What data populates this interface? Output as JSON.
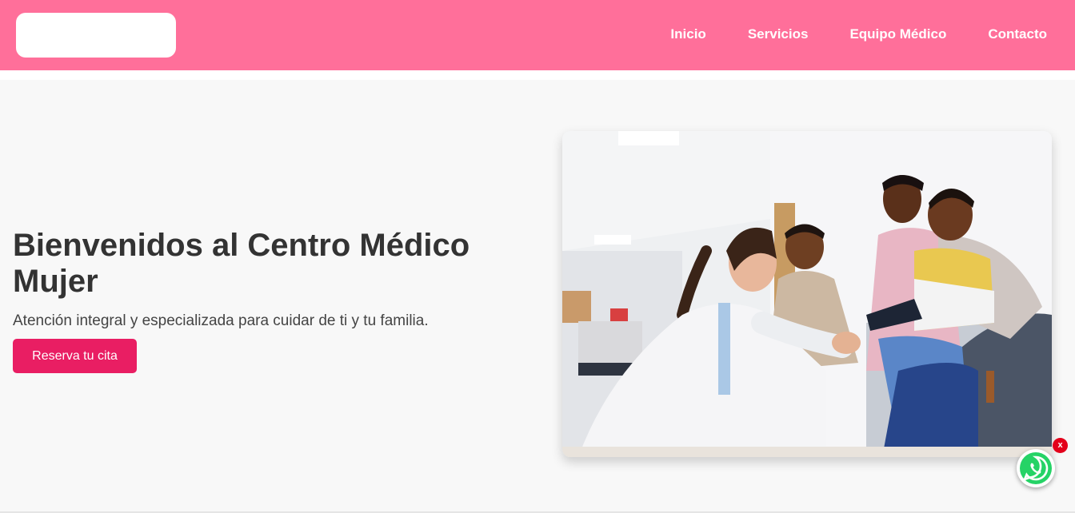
{
  "nav": {
    "items": [
      {
        "label": "Inicio"
      },
      {
        "label": "Servicios"
      },
      {
        "label": "Equipo Médico"
      },
      {
        "label": "Contacto"
      }
    ]
  },
  "hero": {
    "title": "Bienvenidos al Centro Médico Mujer",
    "subtitle": "Atención integral y especializada para cuidar de ti y tu familia.",
    "cta_label": "Reserva tu cita",
    "image_alt": "Doctora atendiendo a un niño con su familia"
  },
  "whatsapp": {
    "icon": "whatsapp-icon",
    "close_label": "x"
  },
  "colors": {
    "header": "#ff6f9a",
    "cta": "#e91e63",
    "hero_bg": "#f8f8f8",
    "whatsapp": "#25d366"
  }
}
